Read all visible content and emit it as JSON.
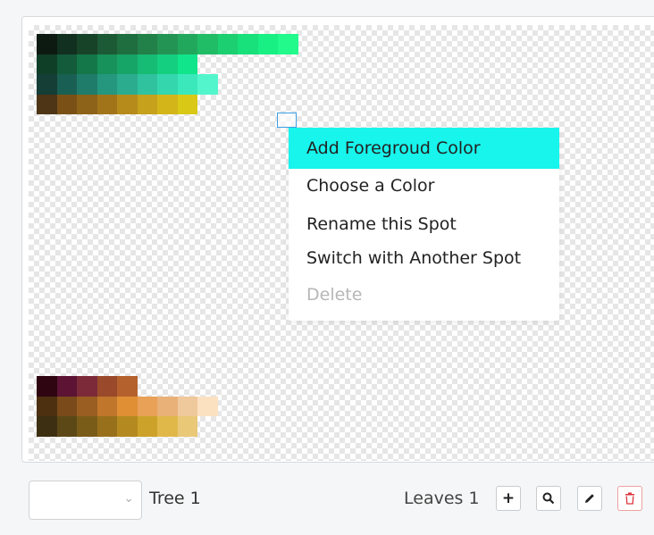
{
  "palette": {
    "top_group": [
      [
        "#0c1a12",
        "#12301f",
        "#174328",
        "#1c5a35",
        "#1f6e3f",
        "#228049",
        "#239454",
        "#22a85c",
        "#20bd66",
        "#1ccf70",
        "#18e07a",
        "#19f083",
        "#22fa8c"
      ],
      [
        "#0f3f27",
        "#135b3a",
        "#137749",
        "#16925a",
        "#17a567",
        "#16bb74",
        "#14cf7f",
        "#11e58b"
      ],
      [
        "#153e37",
        "#1a5f53",
        "#1f7c6a",
        "#25977f",
        "#2bac8f",
        "#30c29f",
        "#34d6ae",
        "#3be8bb",
        "#53f6cc"
      ],
      [
        "#4d3516",
        "#7a5017",
        "#8c6318",
        "#a2741a",
        "#b68b1c",
        "#c6a11c",
        "#d3b51a",
        "#d9c916"
      ]
    ],
    "bottom_group": [
      [
        "#2e0510",
        "#5c1334",
        "#7c2a3a",
        "#9a4a2a",
        "#b5612d"
      ],
      [
        "#4d3010",
        "#7a4a1a",
        "#9a5e22",
        "#c0762b",
        "#e08f35",
        "#e9a057",
        "#e9b178",
        "#efc89c",
        "#fbe1c0"
      ],
      [
        "#3d3012",
        "#5b4816",
        "#7a5c19",
        "#98701c",
        "#b48a20",
        "#cda22b",
        "#e0b84a",
        "#e9c877"
      ]
    ]
  },
  "context_menu": {
    "items": [
      {
        "label": "Add Foregroud Color",
        "state": "highlighted"
      },
      {
        "label": "Choose a Color",
        "state": "normal"
      },
      {
        "label": "Rename this Spot",
        "state": "normal"
      },
      {
        "label": "Switch with Another Spot",
        "state": "normal"
      },
      {
        "label": "Delete",
        "state": "disabled"
      }
    ],
    "highlight_color": "#18f5ec"
  },
  "toolbar": {
    "tree_select_value": "",
    "tree_label": "Tree 1",
    "leaves_label": "Leaves 1",
    "icons": {
      "add": "plus-icon",
      "search": "search-icon",
      "edit": "pencil-icon",
      "delete": "trash-icon",
      "dropdown": "chevron-down-icon"
    }
  }
}
